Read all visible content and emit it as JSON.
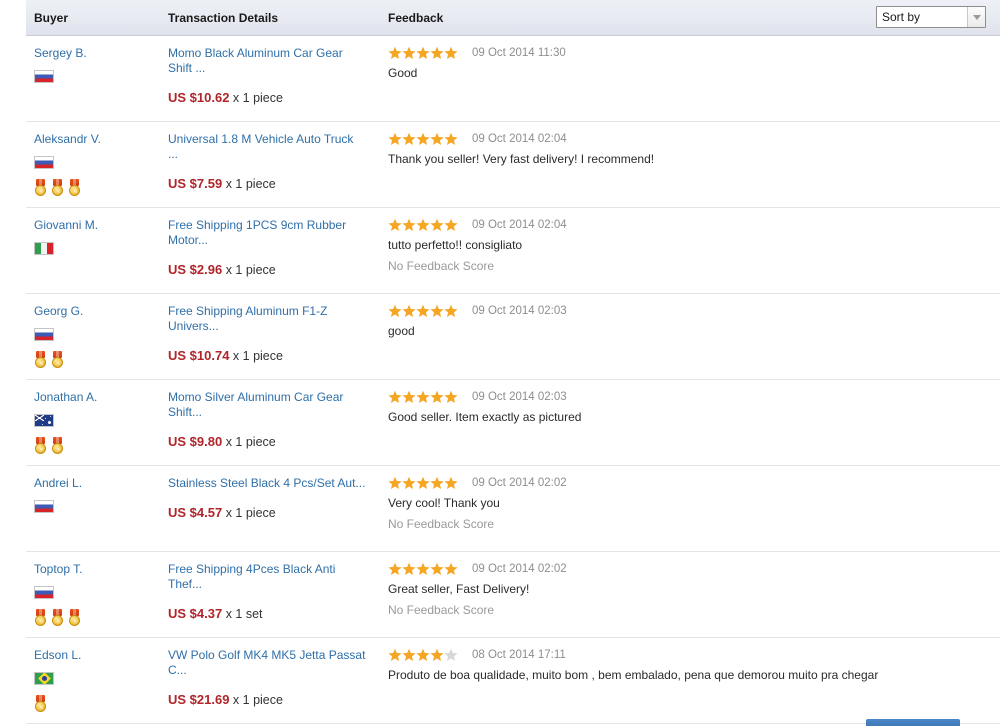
{
  "header": {
    "columns": {
      "buyer": "Buyer",
      "transaction": "Transaction Details",
      "feedback": "Feedback"
    },
    "sort_by": {
      "label": "Sort by",
      "icon": "chevron-down-icon"
    }
  },
  "colors": {
    "link": "#2f6fa8",
    "price": "#b1242a",
    "star_filled": "#f5a623",
    "star_empty": "#d8d8d8",
    "header_bg": "#e8eaf2",
    "divider": "#e4e4e4",
    "muted_text": "#9a9a9a"
  },
  "labels": {
    "no_feedback_score": "No Feedback Score",
    "flag_icon": "country-flag-icon",
    "medal_icon": "medal-icon",
    "star_icon": "star-icon"
  },
  "rows": [
    {
      "buyer": "Sergey B.",
      "country": "ru",
      "medals": 0,
      "item": "Momo Black Aluminum Car Gear Shift ...",
      "price": "US $10.62",
      "qty": "x 1 piece",
      "stars": 5,
      "date": "09 Oct 2014 11:30",
      "comment": "Good",
      "score": ""
    },
    {
      "buyer": "Aleksandr V.",
      "country": "ru",
      "medals": 3,
      "item": "Universal 1.8 M Vehicle Auto Truck ...",
      "price": "US $7.59",
      "qty": "x 1 piece",
      "stars": 5,
      "date": "09 Oct 2014 02:04",
      "comment": "Thank you seller! Very fast delivery! I recommend!",
      "score": ""
    },
    {
      "buyer": "Giovanni M.",
      "country": "it",
      "medals": 0,
      "item": "Free Shipping 1PCS 9cm Rubber Motor...",
      "price": "US $2.96",
      "qty": "x 1 piece",
      "stars": 5,
      "date": "09 Oct 2014 02:04",
      "comment": "tutto perfetto!! consigliato",
      "score": "No Feedback Score"
    },
    {
      "buyer": "Georg G.",
      "country": "ru",
      "medals": 2,
      "item": "Free Shipping Aluminum F1-Z Univers...",
      "price": "US $10.74",
      "qty": "x 1 piece",
      "stars": 5,
      "date": "09 Oct 2014 02:03",
      "comment": "good",
      "score": ""
    },
    {
      "buyer": "Jonathan A.",
      "country": "au",
      "medals": 2,
      "item": "Momo Silver Aluminum Car Gear Shift...",
      "price": "US $9.80",
      "qty": "x 1 piece",
      "stars": 5,
      "date": "09 Oct 2014 02:03",
      "comment": "Good seller. Item exactly as pictured",
      "score": ""
    },
    {
      "buyer": "Andrei L.",
      "country": "ru",
      "medals": 0,
      "item": "Stainless Steel Black 4 Pcs/Set Aut...",
      "price": "US $4.57",
      "qty": "x 1 piece",
      "stars": 5,
      "date": "09 Oct 2014 02:02",
      "comment": "Very cool! Thank you",
      "score": "No Feedback Score"
    },
    {
      "buyer": "Toptop T.",
      "country": "ru",
      "medals": 3,
      "item": "Free Shipping 4Pces Black Anti Thef...",
      "price": "US $4.37",
      "qty": "x 1 set",
      "stars": 5,
      "date": "09 Oct 2014 02:02",
      "comment": "Great seller, Fast Delivery!",
      "score": "No Feedback Score"
    },
    {
      "buyer": "Edson L.",
      "country": "br",
      "medals": 1,
      "item": "VW Polo Golf MK4 MK5 Jetta Passat C...",
      "price": "US $21.69",
      "qty": "x 1 piece",
      "stars": 4,
      "date": "08 Oct 2014 17:11",
      "comment": "Produto de boa qualidade, muito bom , bem embalado, pena que demorou muito pra chegar",
      "score": ""
    }
  ]
}
